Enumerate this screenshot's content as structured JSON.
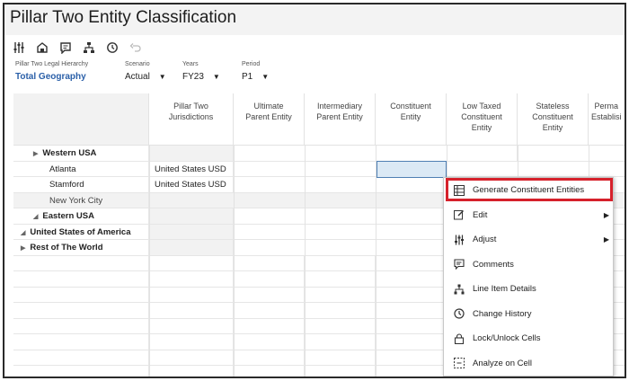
{
  "title": "Pillar Two Entity Classification",
  "toolbar": {
    "icons": [
      "adjust-sliders-icon",
      "home-cube-icon",
      "comment-icon",
      "hierarchy-icon",
      "history-icon",
      "undo-icon"
    ]
  },
  "pov": [
    {
      "label": "Pillar Two Legal Hierarchy",
      "value": "Total Geography"
    },
    {
      "label": "Scenario",
      "value": "Actual"
    },
    {
      "label": "Years",
      "value": "FY23"
    },
    {
      "label": "Period",
      "value": "P1"
    }
  ],
  "columns": [
    {
      "line1": "Pillar Two",
      "line2": "Jurisdictions",
      "line3": ""
    },
    {
      "line1": "Ultimate",
      "line2": "Parent Entity",
      "line3": ""
    },
    {
      "line1": "Intermediary",
      "line2": "Parent Entity",
      "line3": ""
    },
    {
      "line1": "Constituent",
      "line2": "Entity",
      "line3": ""
    },
    {
      "line1": "Low Taxed",
      "line2": "Constituent",
      "line3": "Entity"
    },
    {
      "line1": "Stateless",
      "line2": "Constituent",
      "line3": "Entity"
    },
    {
      "line1": "Perma",
      "line2": "Establisi",
      "line3": ""
    }
  ],
  "rows": [
    {
      "label": "Western USA",
      "jurisdiction": ""
    },
    {
      "label": "Atlanta",
      "jurisdiction": "United States USD"
    },
    {
      "label": "Stamford",
      "jurisdiction": "United States USD"
    },
    {
      "label": "New York City",
      "jurisdiction": ""
    },
    {
      "label": "Eastern USA",
      "jurisdiction": ""
    },
    {
      "label": "United States of America",
      "jurisdiction": ""
    },
    {
      "label": "Rest of The World",
      "jurisdiction": ""
    }
  ],
  "context_menu": [
    {
      "label": "Generate Constituent Entities",
      "icon": "table-grid-icon",
      "submenu": false
    },
    {
      "label": "Edit",
      "icon": "edit-icon",
      "submenu": true
    },
    {
      "label": "Adjust",
      "icon": "adjust-sliders-icon",
      "submenu": true
    },
    {
      "label": "Comments",
      "icon": "comment-icon",
      "submenu": false
    },
    {
      "label": "Line Item Details",
      "icon": "hierarchy-icon",
      "submenu": false
    },
    {
      "label": "Change History",
      "icon": "history-icon",
      "submenu": false
    },
    {
      "label": "Lock/Unlock Cells",
      "icon": "lock-icon",
      "submenu": false
    },
    {
      "label": "Analyze on Cell",
      "icon": "analyze-icon",
      "submenu": false
    }
  ],
  "colors": {
    "highlight": "#d6212b",
    "link": "#2a5fa8",
    "selected_cell": "#dbe9f5"
  }
}
